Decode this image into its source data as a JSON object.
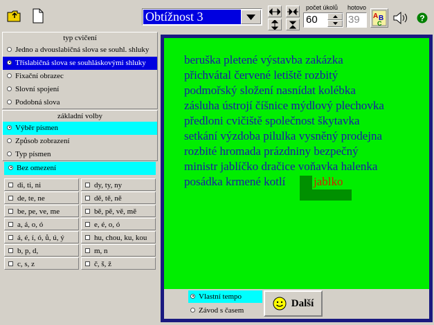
{
  "toolbar": {
    "difficulty": "Obtížnost 3",
    "count_label": "počet úkolů",
    "count_value": "60",
    "done_label": "hotovo",
    "done_value": "39"
  },
  "left": {
    "exercise_title": "typ cvičení",
    "exercise_items": [
      "Jedno a dvouslabičná slova se souhl. shluky",
      "Tříslabičná slova se souhláskovými shluky",
      "Fixační obrazec",
      "Slovní spojení",
      "Podobná slova"
    ],
    "basic_title": "základní volby",
    "basic_items": [
      "Výběr písmen",
      "Způsob zobrazení",
      "Typ písmen"
    ],
    "no_limit": "Bez omezení",
    "letter_pairs": [
      [
        "di, ti, ni",
        "dy, ty, ny"
      ],
      [
        "de, te, ne",
        "dě, tě, ně"
      ],
      [
        "be, pe, ve, me",
        "bě, pě, vě, mě"
      ],
      [
        "a, á, o, ó",
        "e, é, o, ó"
      ],
      [
        "á, é, í, ó, ů, ú, ý",
        "hu, chou, ku, kou"
      ],
      [
        "b, p, d,",
        "m, n"
      ],
      [
        "c, s, z",
        "č, š, ž"
      ]
    ]
  },
  "main": {
    "lines": [
      "beruška pletené výstavba zakázka",
      "přichvátal červené letiště rozbitý",
      "podmořský složení nasnídat kolébka",
      "zásluha ústrojí číšnice mýdlový plechovka",
      "předloni cvičiště společnost škytavka",
      "setkání výzdoba pilulka vysněný prodejna",
      "rozbité hromada prázdniny bezpečný",
      "ministr jablíčko dračice voňavka halenka"
    ],
    "last_line": "posádka krmené kotlí",
    "current_word": "jablko"
  },
  "bottom": {
    "own_pace": "Vlastní tempo",
    "time_race": "Závod s časem",
    "next_label": "Další"
  },
  "colors": {
    "reading_bg": "#00ee00",
    "text": "#1a1aa8",
    "current_word": "#d02000",
    "selected": "#0000e0",
    "highlight": "#00ffff"
  }
}
